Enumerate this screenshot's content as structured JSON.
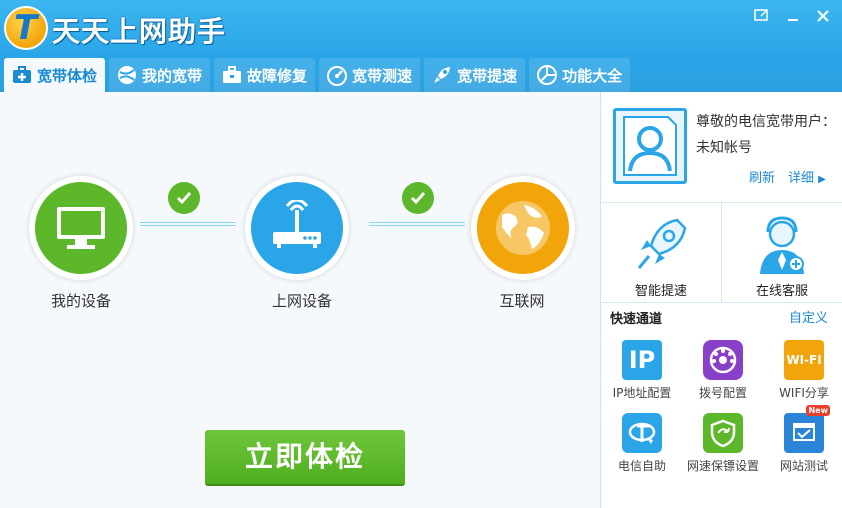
{
  "app": {
    "title": "天天上网助手"
  },
  "tabs": [
    {
      "label": "宽带体检",
      "icon": "medical-case-icon",
      "active": true
    },
    {
      "label": "我的宽带",
      "icon": "broadband-ball-icon",
      "active": false
    },
    {
      "label": "故障修复",
      "icon": "toolbox-icon",
      "active": false
    },
    {
      "label": "宽带测速",
      "icon": "speedometer-icon",
      "active": false
    },
    {
      "label": "宽带提速",
      "icon": "rocket-icon",
      "active": false
    },
    {
      "label": "功能大全",
      "icon": "apps-icon",
      "active": false
    }
  ],
  "diagram": {
    "nodes": [
      {
        "label": "我的设备",
        "icon": "monitor-icon",
        "color": "#5cb82a"
      },
      {
        "label": "上网设备",
        "icon": "router-icon",
        "color": "#2aa6e8"
      },
      {
        "label": "互联网",
        "icon": "globe-icon",
        "color": "#f2a40b"
      }
    ]
  },
  "actions": {
    "check_now": "立即体检"
  },
  "account": {
    "greeting": "尊敬的电信宽带用户：",
    "name": "未知帐号",
    "refresh": "刷新",
    "details": "详细"
  },
  "services": [
    {
      "label": "智能提速",
      "icon": "rocket-icon"
    },
    {
      "label": "在线客服",
      "icon": "customer-service-icon"
    }
  ],
  "quick": {
    "title": "快速通道",
    "customize": "自定义",
    "items": [
      {
        "label": "IP地址配置",
        "icon": "ip-icon",
        "text": "IP",
        "color": "#2aa6e8"
      },
      {
        "label": "拨号配置",
        "icon": "dial-icon",
        "text": "",
        "color": "#8a3fc9"
      },
      {
        "label": "WIFI分享",
        "icon": "wifi-icon",
        "text": "WI-FI",
        "color": "#f2a40b"
      },
      {
        "label": "电信自助",
        "icon": "telecom-icon",
        "text": "",
        "color": "#2aa6e8"
      },
      {
        "label": "网速保镖设置",
        "icon": "shield-icon",
        "text": "",
        "color": "#5cb82a"
      },
      {
        "label": "网站测试",
        "icon": "website-test-icon",
        "text": "",
        "color": "#2a85d8",
        "badge": "New"
      }
    ]
  },
  "colors": {
    "brand": "#2aa6e8",
    "ok": "#5cb82a",
    "link": "#1a8ad4"
  }
}
